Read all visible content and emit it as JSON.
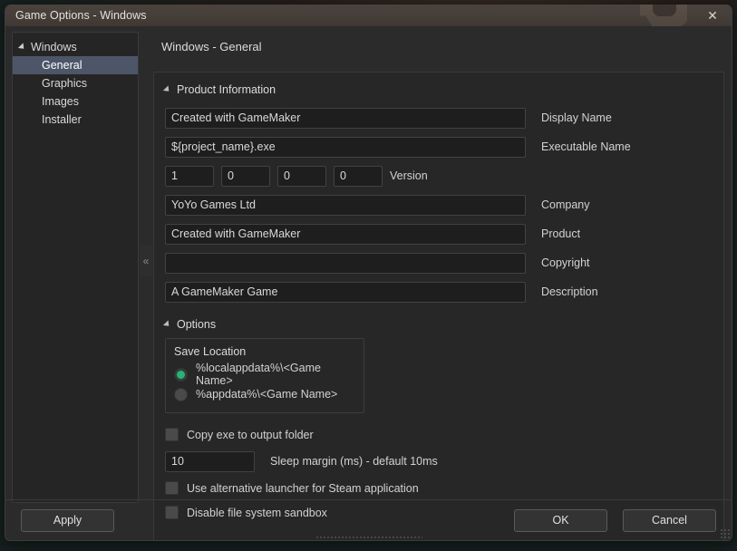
{
  "window": {
    "title": "Game Options - Windows",
    "close_icon": "close-icon",
    "collapse_handle": "«"
  },
  "sidebar": {
    "root": {
      "label": "Windows",
      "expand_icon": "triangle-down-icon"
    },
    "items": [
      {
        "label": "General",
        "selected": true
      },
      {
        "label": "Graphics",
        "selected": false
      },
      {
        "label": "Images",
        "selected": false
      },
      {
        "label": "Installer",
        "selected": false
      }
    ]
  },
  "content": {
    "heading": "Windows - General",
    "product_information": {
      "section_label": "Product Information",
      "fields": [
        {
          "value": "Created with GameMaker",
          "label": "Display Name"
        },
        {
          "value": "${project_name}.exe",
          "label": "Executable Name"
        }
      ],
      "version": {
        "label": "Version",
        "parts": [
          "1",
          "0",
          "0",
          "0"
        ]
      },
      "fields2": [
        {
          "value": "YoYo Games Ltd",
          "label": "Company"
        },
        {
          "value": "Created with GameMaker",
          "label": "Product"
        },
        {
          "value": "",
          "label": "Copyright"
        },
        {
          "value": "A GameMaker Game",
          "label": "Description"
        }
      ]
    },
    "options": {
      "section_label": "Options",
      "save_location": {
        "title": "Save Location",
        "choices": [
          {
            "label": "%localappdata%\\<Game Name>",
            "selected": true
          },
          {
            "label": "%appdata%\\<Game Name>",
            "selected": false
          }
        ]
      },
      "copy_exe": {
        "label": "Copy exe to output folder",
        "checked": false
      },
      "sleep_margin": {
        "value": "10",
        "label": "Sleep margin (ms) - default 10ms"
      },
      "alt_launcher": {
        "label": "Use alternative launcher for Steam application",
        "checked": false
      },
      "disable_sandbox": {
        "label": "Disable file system sandbox",
        "checked": false
      }
    }
  },
  "footer": {
    "apply": "Apply",
    "ok": "OK",
    "cancel": "Cancel"
  },
  "colors": {
    "accent_selected": "#4d5668",
    "radio_on": "#22b573",
    "titlebar": "#463e38",
    "panel": "#272727"
  }
}
